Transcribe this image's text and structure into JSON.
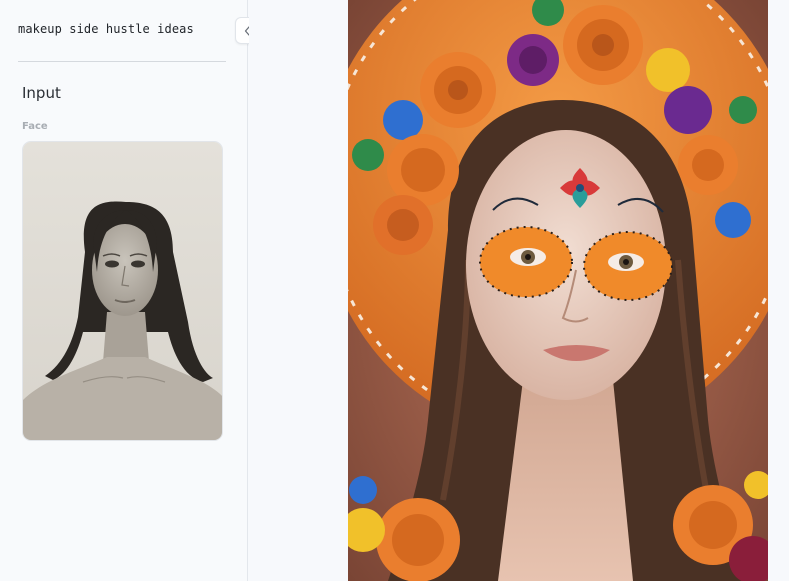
{
  "sidebar": {
    "title": "makeup side hustle ideas",
    "section_heading": "Input",
    "face_label": "Face"
  },
  "collapse_button": {
    "icon": "double-chevron-left-icon"
  },
  "input_image": {
    "icon": "face-photo",
    "style": "black-and-white portrait"
  },
  "output_image": {
    "icon": "makeup-result-photo",
    "style": "sugar-skull makeup with flower crown"
  },
  "colors": {
    "sidebar_bg": "#f8fafc",
    "border": "#e3e7ec",
    "title_text": "#1f2328",
    "label_text": "#a8adb3",
    "hat_orange": "#e8832f"
  }
}
